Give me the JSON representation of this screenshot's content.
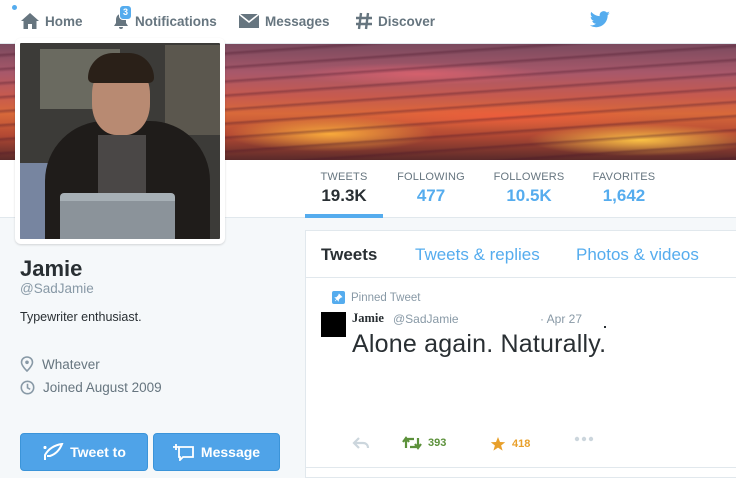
{
  "nav": {
    "home": "Home",
    "notifications": "Notifications",
    "notification_count": "3",
    "messages": "Messages",
    "discover": "Discover"
  },
  "stats": {
    "tweets_label": "TWEETS",
    "tweets_value": "19.3K",
    "following_label": "FOLLOWING",
    "following_value": "477",
    "followers_label": "FOLLOWERS",
    "followers_value": "10.5K",
    "favorites_label": "FAVORITES",
    "favorites_value": "1,642"
  },
  "profile": {
    "name": "Jamie",
    "handle": "@SadJamie",
    "bio": "Typewriter enthusiast.",
    "location": "Whatever",
    "joined": "Joined August 2009"
  },
  "buttons": {
    "tweet_to": "Tweet to",
    "message": "Message"
  },
  "tabs": {
    "tweets": "Tweets",
    "tweets_replies": "Tweets & replies",
    "photos_videos": "Photos & videos"
  },
  "tweet": {
    "pinned_label": "Pinned Tweet",
    "author_name": "Jamie",
    "author_handle": "@SadJamie",
    "date": "· Apr 27",
    "text": "Alone again. Naturally.",
    "retweets": "393",
    "favorites": "418"
  },
  "colors": {
    "accent": "#55acee",
    "retweet": "#5c913b",
    "favorite": "#e8a02b"
  }
}
